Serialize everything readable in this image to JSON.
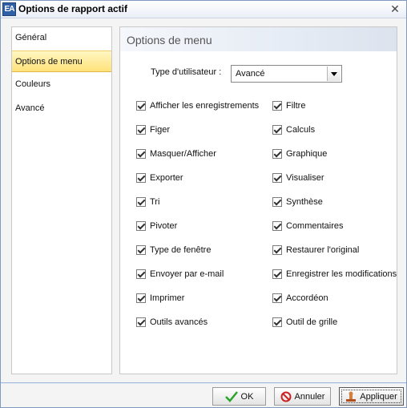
{
  "window": {
    "title": "Options de rapport actif",
    "app_icon_text": "EA",
    "close_glyph": "✕"
  },
  "sidebar": {
    "items": [
      {
        "label": "Général",
        "selected": false
      },
      {
        "label": "Options de menu",
        "selected": true
      },
      {
        "label": "Couleurs",
        "selected": false
      },
      {
        "label": "Avancé",
        "selected": false
      }
    ]
  },
  "panel": {
    "title": "Options de menu",
    "user_type_label": "Type d'utilisateur :",
    "user_type_value": "Avancé",
    "left_options": [
      {
        "label": "Afficher les enregistrements",
        "checked": true
      },
      {
        "label": "Figer",
        "checked": true
      },
      {
        "label": "Masquer/Afficher",
        "checked": true
      },
      {
        "label": "Exporter",
        "checked": true
      },
      {
        "label": "Tri",
        "checked": true
      },
      {
        "label": "Pivoter",
        "checked": true
      },
      {
        "label": "Type de fenêtre",
        "checked": true
      },
      {
        "label": "Envoyer par e-mail",
        "checked": true
      },
      {
        "label": "Imprimer",
        "checked": true
      },
      {
        "label": "Outils avancés",
        "checked": true
      }
    ],
    "right_options": [
      {
        "label": "Filtre",
        "checked": true
      },
      {
        "label": "Calculs",
        "checked": true
      },
      {
        "label": "Graphique",
        "checked": true
      },
      {
        "label": "Visualiser",
        "checked": true
      },
      {
        "label": "Synthèse",
        "checked": true
      },
      {
        "label": "Commentaires",
        "checked": true
      },
      {
        "label": "Restaurer l'original",
        "checked": true
      },
      {
        "label": "Enregistrer les modifications",
        "checked": true
      },
      {
        "label": "Accordéon",
        "checked": true
      },
      {
        "label": "Outil de grille",
        "checked": true
      }
    ]
  },
  "buttons": {
    "ok": "OK",
    "cancel": "Annuler",
    "apply": "Appliquer"
  },
  "colors": {
    "ok_icon": "#2aa52a",
    "cancel_icon": "#cc2222",
    "selected_nav": "#ffe27a"
  }
}
